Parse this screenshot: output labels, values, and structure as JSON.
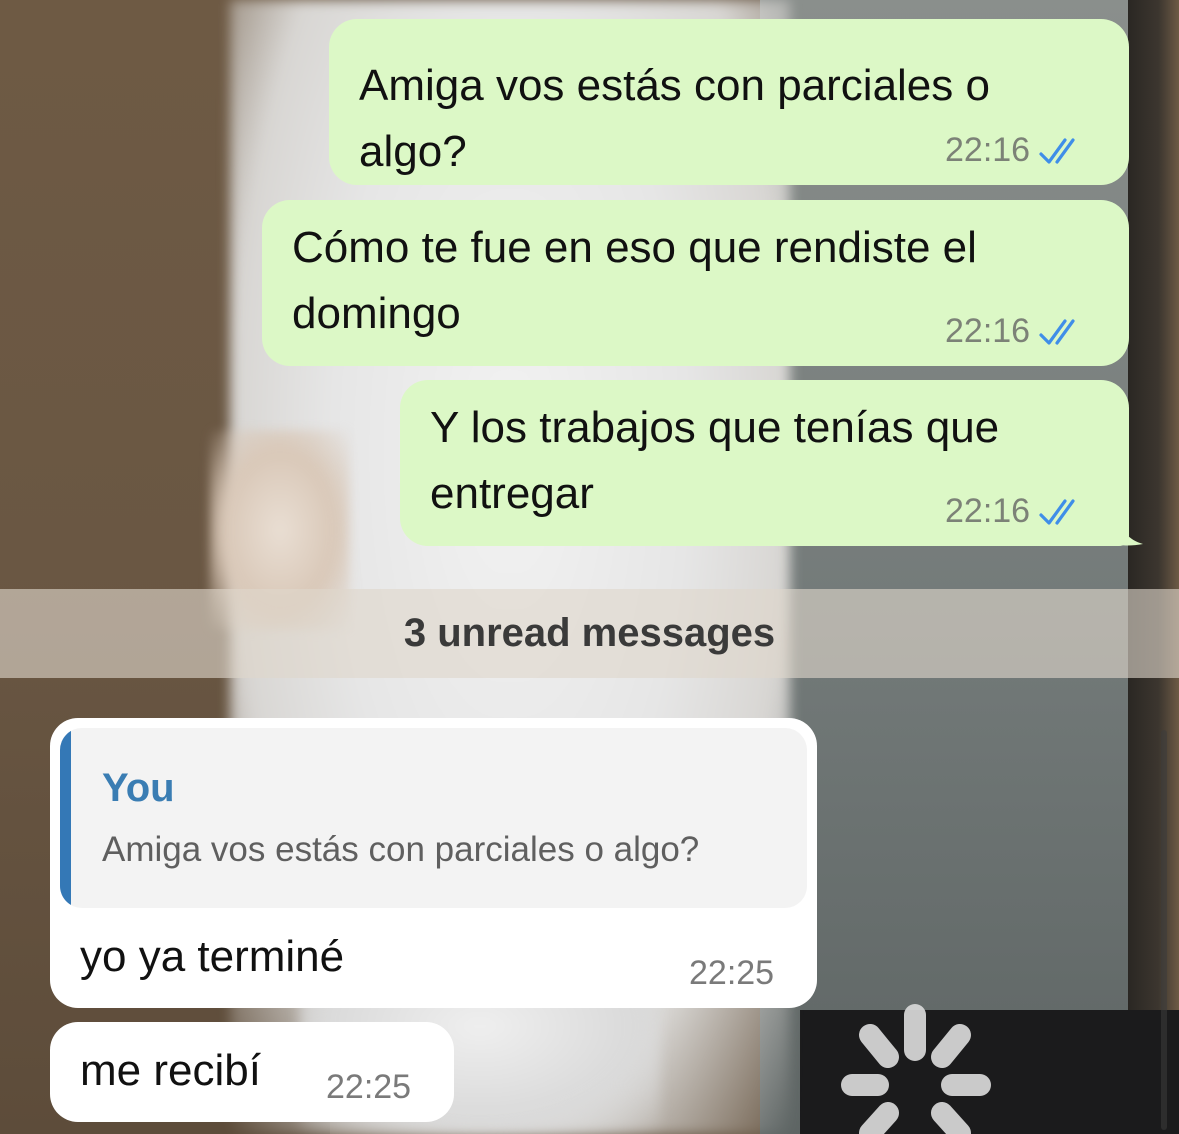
{
  "messages_outgoing": [
    {
      "lines": [
        "Amiga vos estás con parciales o",
        "algo?"
      ],
      "time": "22:16",
      "status": "read"
    },
    {
      "lines": [
        "Cómo te fue en eso que rendiste el",
        "domingo"
      ],
      "time": "22:16",
      "status": "read"
    },
    {
      "lines": [
        "Y los trabajos que tenías que",
        "entregar"
      ],
      "time": "22:16",
      "status": "read"
    }
  ],
  "unread_divider": {
    "label": "3 unread messages"
  },
  "messages_incoming": [
    {
      "reply_to": {
        "author": "You",
        "text": "Amiga vos estás con parciales o algo?"
      },
      "text": "yo ya terminé",
      "time": "22:25"
    },
    {
      "text": "me recibí",
      "time": "22:25"
    }
  ],
  "colors": {
    "outgoing_bubble": "#dcf8c6",
    "incoming_bubble": "#ffffff",
    "read_tick": "#3f8ee8",
    "quote_accent": "#3478b6"
  },
  "icons": {
    "read_receipt": "double-check-icon",
    "loading": "spinner-icon"
  }
}
